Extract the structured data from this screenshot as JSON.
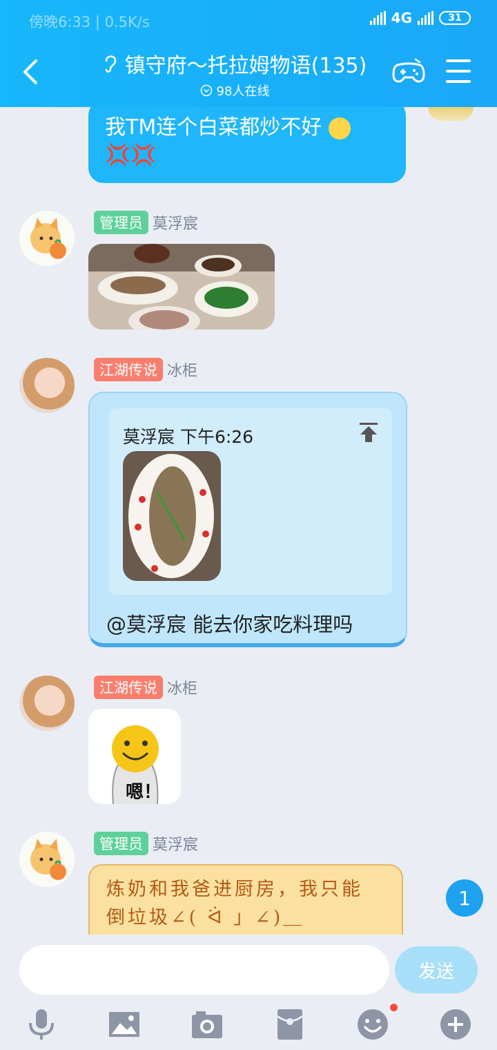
{
  "status_bar": {
    "time": "傍晚6:33",
    "speed": "0.5K/s",
    "network": "4G",
    "battery": "31"
  },
  "header": {
    "title": "镇守府～托拉姆物语(135)",
    "online": "98人在线"
  },
  "messages": [
    {
      "text_line1": "我TM连个白菜都炒不好",
      "text_line2": "💢💢"
    },
    {
      "tag": "管理员",
      "sender": "莫浮宸",
      "kind": "image"
    },
    {
      "tag": "江湖传说",
      "sender": "冰柜",
      "quote_header": "莫浮宸 下午6:26",
      "text": "@莫浮宸 能去你家吃料理吗"
    },
    {
      "tag": "江湖传说",
      "sender": "冰柜",
      "sticker_text": "嗯！"
    },
    {
      "tag": "管理员",
      "sender": "莫浮宸",
      "text_line1": "炼奶和我爸进厨房，我只能",
      "text_line2": "倒垃圾∠( ᐛ 」∠)＿"
    }
  ],
  "unread_badge": "1",
  "composer": {
    "placeholder": "",
    "send_label": "发送"
  },
  "colors": {
    "header": "#17b7fb",
    "self_bubble": "#1fb6fb",
    "admin_tag": "#5ed19a",
    "legend_tag": "#fa7e6e"
  },
  "icons": {
    "toolbar": [
      "microphone-icon",
      "image-icon",
      "camera-icon",
      "red-packet-icon",
      "emoji-icon",
      "plus-icon"
    ]
  }
}
